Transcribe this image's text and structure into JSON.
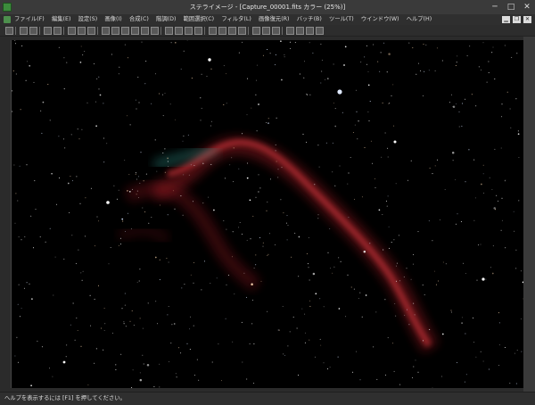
{
  "title": "ステライメージ - [Capture_00001.fits カラー (25%)]",
  "menu": [
    "ファイル(F)",
    "編集(E)",
    "設定(S)",
    "画像(I)",
    "合成(C)",
    "階調(D)",
    "範囲選択(C)",
    "フィルタ(L)",
    "画像復元(R)",
    "バッチ(B)",
    "ツール(T)",
    "ウインドウ(W)",
    "ヘルプ(H)"
  ],
  "status": "ヘルプを表示するには [F1] を押してください。",
  "colors": {
    "background": "#2b2b2b",
    "image_bg": "#000000",
    "nebula_red": "#b4232a",
    "nebula_teal": "#2f8f86"
  }
}
